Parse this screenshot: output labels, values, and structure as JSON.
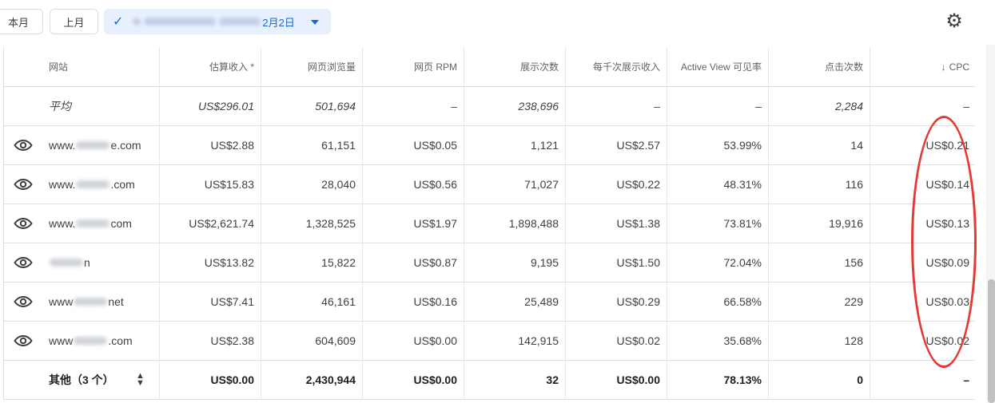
{
  "toolbar": {
    "chip_this_month": "本月",
    "chip_last_month": "上月",
    "date_range_suffix": "2月2日",
    "settings_icon": "gear-icon"
  },
  "columns": {
    "site": "网站",
    "est_revenue": "估算收入 *",
    "page_views": "网页浏览量",
    "page_rpm": "网页 RPM",
    "impressions": "展示次数",
    "impression_rpm": "每千次展示收入",
    "active_view": "Active View 可见率",
    "clicks": "点击次数",
    "cpc": "CPC"
  },
  "average": {
    "label": "平均",
    "est_revenue": "US$296.01",
    "page_views": "501,694",
    "page_rpm": "–",
    "impressions": "238,696",
    "impression_rpm": "–",
    "active_view": "–",
    "clicks": "2,284",
    "cpc": "–"
  },
  "rows": [
    {
      "site_prefix": "www.",
      "site_suffix": "e.com",
      "est_revenue": "US$2.88",
      "page_views": "61,151",
      "page_rpm": "US$0.05",
      "impressions": "1,121",
      "impression_rpm": "US$2.57",
      "active_view": "53.99%",
      "clicks": "14",
      "cpc": "US$0.21"
    },
    {
      "site_prefix": "www.",
      "site_suffix": ".com",
      "est_revenue": "US$15.83",
      "page_views": "28,040",
      "page_rpm": "US$0.56",
      "impressions": "71,027",
      "impression_rpm": "US$0.22",
      "active_view": "48.31%",
      "clicks": "116",
      "cpc": "US$0.14"
    },
    {
      "site_prefix": "www.",
      "site_suffix": "com",
      "est_revenue": "US$2,621.74",
      "page_views": "1,328,525",
      "page_rpm": "US$1.97",
      "impressions": "1,898,488",
      "impression_rpm": "US$1.38",
      "active_view": "73.81%",
      "clicks": "19,916",
      "cpc": "US$0.13"
    },
    {
      "site_prefix": "",
      "site_suffix": "n",
      "est_revenue": "US$13.82",
      "page_views": "15,822",
      "page_rpm": "US$0.87",
      "impressions": "9,195",
      "impression_rpm": "US$1.50",
      "active_view": "72.04%",
      "clicks": "156",
      "cpc": "US$0.09"
    },
    {
      "site_prefix": "www",
      "site_suffix": "net",
      "est_revenue": "US$7.41",
      "page_views": "46,161",
      "page_rpm": "US$0.16",
      "impressions": "25,489",
      "impression_rpm": "US$0.29",
      "active_view": "66.58%",
      "clicks": "229",
      "cpc": "US$0.03"
    },
    {
      "site_prefix": "www",
      "site_suffix": ".com",
      "est_revenue": "US$2.38",
      "page_views": "604,609",
      "page_rpm": "US$0.00",
      "impressions": "142,915",
      "impression_rpm": "US$0.02",
      "active_view": "35.68%",
      "clicks": "128",
      "cpc": "US$0.02"
    }
  ],
  "others": {
    "label": "其他（3 个）",
    "est_revenue": "US$0.00",
    "page_views": "2,430,944",
    "page_rpm": "US$0.00",
    "impressions": "32",
    "impression_rpm": "US$0.00",
    "active_view": "78.13%",
    "clicks": "0",
    "cpc": "–"
  },
  "colors": {
    "accent": "#1967d2",
    "chip_selected_bg": "#e8f0fe",
    "annotation": "#e53935"
  }
}
